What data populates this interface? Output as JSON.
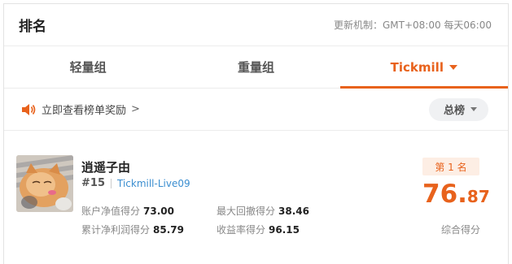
{
  "header": {
    "title": "排名",
    "update_text": "更新机制：GMT+08:00 每天06:00"
  },
  "tabs": [
    {
      "label": "轻量组",
      "active": false
    },
    {
      "label": "重量组",
      "active": false
    },
    {
      "label": "Tickmill",
      "active": true
    }
  ],
  "promo": {
    "icon": "speaker-icon",
    "text": "立即查看榜单奖励",
    "chevron": ">"
  },
  "filter": {
    "label": "总榜"
  },
  "entry": {
    "name": "逍遥子由",
    "rank_hash": "#15",
    "account": "Tickmill-Live09",
    "stats": [
      {
        "label": "账户净值得分",
        "value": "73.00"
      },
      {
        "label": "最大回撤得分",
        "value": "38.46"
      },
      {
        "label": "累计净利润得分",
        "value": "85.79"
      },
      {
        "label": "收益率得分",
        "value": "96.15"
      }
    ],
    "rank_badge": "第 1 名",
    "score_int": "76.",
    "score_dec": "87",
    "score_label": "综合得分"
  },
  "colors": {
    "accent": "#e8621c",
    "link": "#3b8ed0"
  }
}
